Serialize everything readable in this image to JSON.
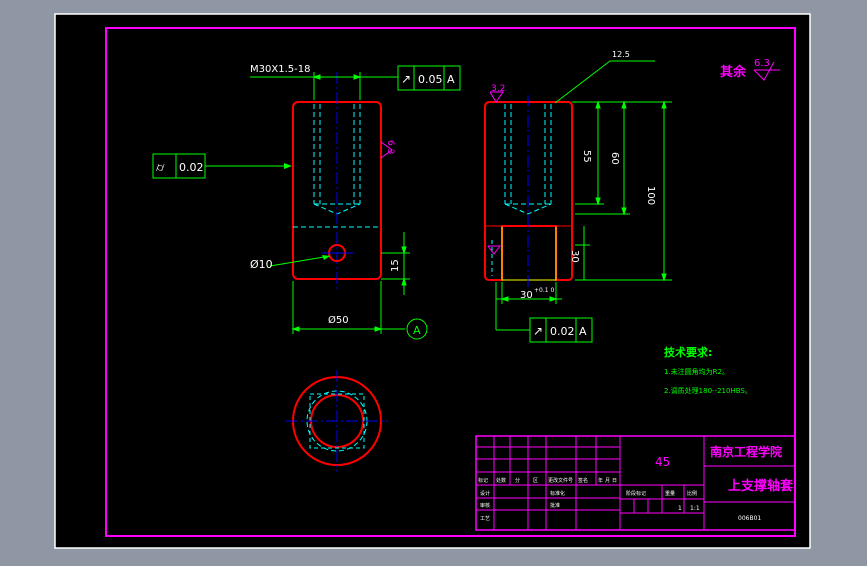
{
  "colors": {
    "background": "#8f96a4",
    "sheet": "#000000",
    "outer_border": "#ffffff",
    "frame": "#ff00ff",
    "outline": "#ff0000",
    "hidden": "#00ffff",
    "centerline": "#0000ff",
    "dimension": "#00ff00",
    "annotation": "#ffffff",
    "title_text": "#ff00ff",
    "insert": "#ffff00"
  },
  "front_view": {
    "thread_callout": "M30X1.5-18",
    "tolerance_top": {
      "symbol": "↗",
      "value": "0.05",
      "datum": "A"
    },
    "tolerance_left": {
      "symbol": "⌭",
      "value": "0.02"
    },
    "roughness_side": "6.3",
    "hole_diameter": "Ø10",
    "width_dim": "Ø50",
    "hole_offset_dim": "15",
    "datum_label": "A"
  },
  "side_view": {
    "roughness_top": "3.2",
    "roughness_leader": "12.5",
    "dim_55": "55",
    "dim_60": "60",
    "dim_100": "100",
    "dim_30": "30",
    "slot_width": "30",
    "slot_tolerance": "+0.1\n0",
    "tolerance_bottom": {
      "symbol": "↗",
      "value": "0.02",
      "datum": "A"
    }
  },
  "general_roughness": {
    "label": "其余",
    "value": "6.3"
  },
  "technical_requirements": {
    "heading": "技术要求:",
    "items": [
      "1.未注圆角均为R2。",
      "2.调质处理180--210HBS。"
    ]
  },
  "title_block": {
    "material": "45",
    "school": "南京工程学院",
    "part_name": "上支撑轴套",
    "drawing_no": "006B01",
    "revision_labels": [
      "标记",
      "处数",
      "分",
      "区",
      "更改文件号",
      "签名",
      "年",
      "月",
      "日"
    ],
    "role_labels": [
      "设计",
      "标准化",
      "审核",
      "工艺",
      "批准"
    ],
    "stage_labels": [
      "阶段标记",
      "重量",
      "比例"
    ],
    "scale": "1:1",
    "sheet_count": "1"
  }
}
